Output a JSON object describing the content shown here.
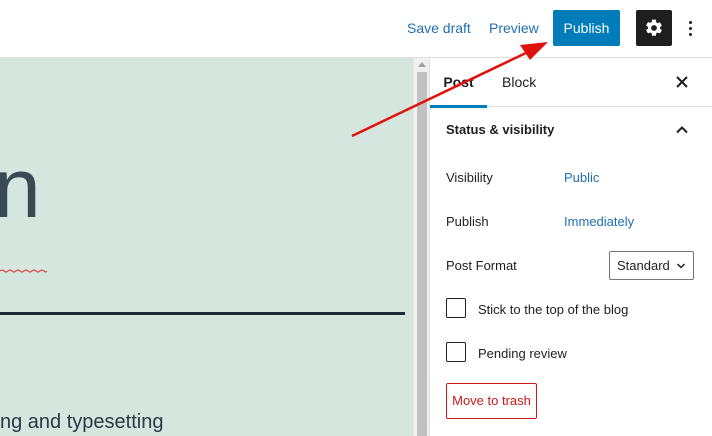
{
  "toolbar": {
    "save_draft": "Save draft",
    "preview": "Preview",
    "publish": "Publish",
    "settings_icon": "gear-icon",
    "more_icon": "vertical-ellipsis-icon"
  },
  "canvas": {
    "heading_fragment": "n",
    "body_fragment": "ng and typesetting",
    "background": "#d5e6df"
  },
  "sidebar": {
    "tabs": [
      {
        "label": "Post",
        "active": true
      },
      {
        "label": "Block",
        "active": false
      }
    ],
    "close_icon": "close-icon",
    "panel": {
      "title": "Status & visibility",
      "expanded": true,
      "visibility_label": "Visibility",
      "visibility_value": "Public",
      "publish_label": "Publish",
      "publish_value": "Immediately",
      "format_label": "Post Format",
      "format_value": "Standard",
      "sticky_label": "Stick to the top of the blog",
      "sticky_checked": false,
      "pending_label": "Pending review",
      "pending_checked": false,
      "trash_label": "Move to trash"
    }
  },
  "colors": {
    "accent": "#007cba",
    "link": "#1f6fb2",
    "danger": "#cc1818",
    "annotation": "#e0120e"
  }
}
